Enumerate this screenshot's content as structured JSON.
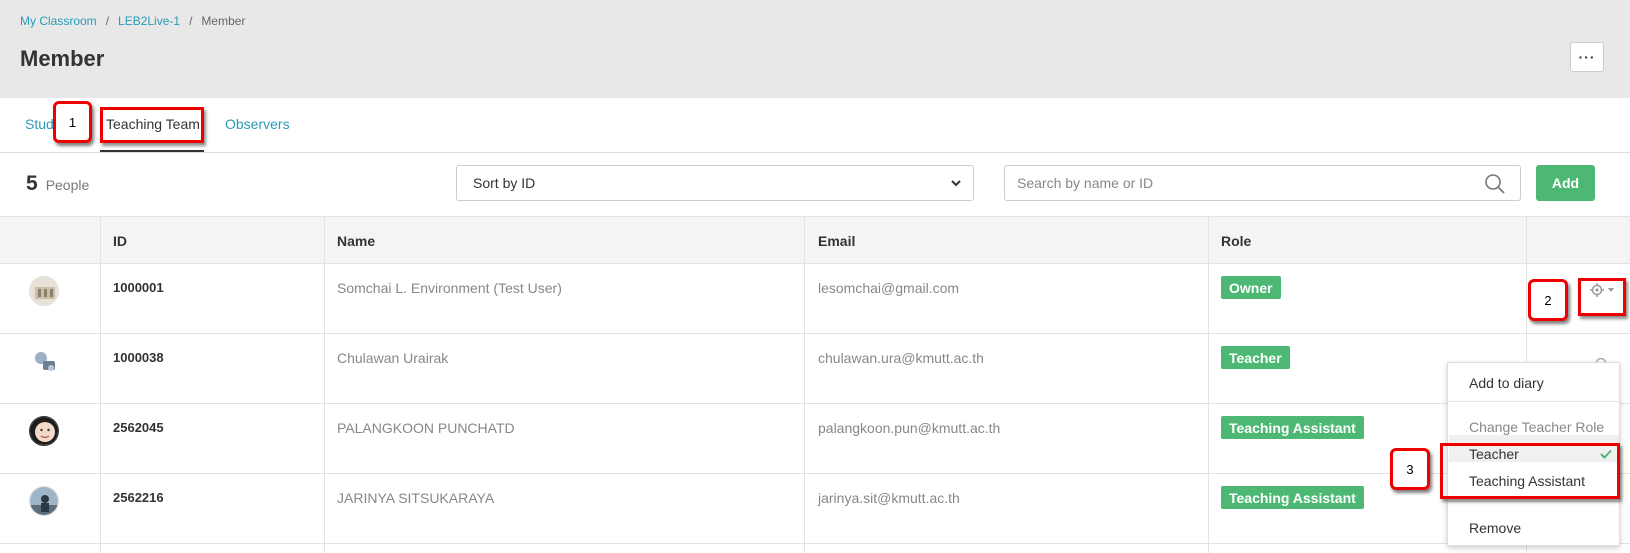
{
  "breadcrumb": {
    "items": [
      "My Classroom",
      "LEB2Live-1",
      "Member"
    ],
    "separator": "/"
  },
  "page": {
    "title": "Member",
    "more_label": "···"
  },
  "tabs": [
    {
      "label": "Stud",
      "active": false
    },
    {
      "label": "Teaching Team",
      "active": true
    },
    {
      "label": "Observers",
      "active": false
    }
  ],
  "annotations": {
    "callout_1": "1",
    "callout_2": "2",
    "callout_3": "3"
  },
  "toolbar": {
    "count": "5",
    "count_label": "People",
    "sort_value": "Sort by ID",
    "search_placeholder": "Search by name or ID",
    "add_label": "Add"
  },
  "table": {
    "headers": {
      "id": "ID",
      "name": "Name",
      "email": "Email",
      "role": "Role"
    },
    "rows": [
      {
        "id": "1000001",
        "name": "Somchai L. Environment (Test User)",
        "email": "lesomchai@gmail.com",
        "role": "Owner"
      },
      {
        "id": "1000038",
        "name": "Chulawan Urairak",
        "email": "chulawan.ura@kmutt.ac.th",
        "role": "Teacher"
      },
      {
        "id": "2562045",
        "name": "PALANGKOON PUNCHATD",
        "email": "palangkoon.pun@kmutt.ac.th",
        "role": "Teaching Assistant"
      },
      {
        "id": "2562216",
        "name": "JARINYA SITSUKARAYA",
        "email": "jarinya.sit@kmutt.ac.th",
        "role": "Teaching Assistant"
      }
    ]
  },
  "menu": {
    "add_to_diary": "Add to diary",
    "change_role_header": "Change Teacher Role",
    "role_teacher": "Teacher",
    "role_ta": "Teaching Assistant",
    "remove": "Remove"
  },
  "colors": {
    "accent": "#2a9bb5",
    "badge": "#4cb874",
    "annotation": "#e00000"
  }
}
